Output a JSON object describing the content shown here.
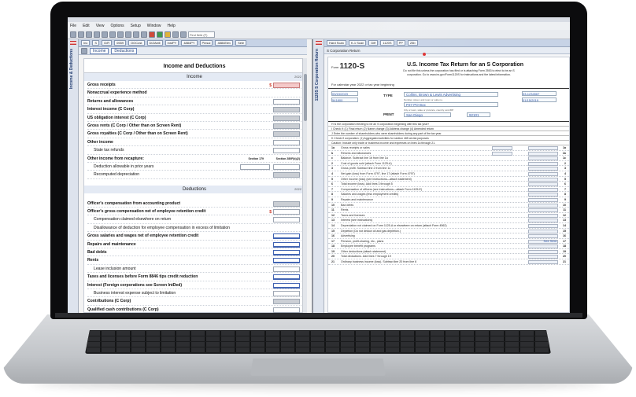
{
  "menu": [
    "File",
    "Edit",
    "View",
    "Options",
    "Setup",
    "Window",
    "Help"
  ],
  "toolbar": {
    "search_placeholder": "Find field (F)"
  },
  "left_pane": {
    "vertical_tab": "Income & Deductions",
    "form_bar": [
      "Inc",
      "S",
      "G/R",
      "0559",
      "OOCost",
      "DIZAbill",
      "InstPY",
      "4884PY",
      "Pinsul",
      "4884Elev",
      "Sele"
    ],
    "nav_tabs": [
      "Income",
      "Deductions"
    ],
    "sheet_title": "Income and Deductions",
    "income_section": "Income",
    "year_tag": "2022",
    "income_rows": [
      {
        "label": "Gross receipts",
        "indent": false,
        "box": "pk"
      },
      {
        "label": "Nonaccrual experience method",
        "indent": false,
        "box": "none"
      },
      {
        "label": "Returns and allowances",
        "indent": false,
        "box": "wh"
      },
      {
        "label": "Interest income (C Corp)",
        "indent": false,
        "box": "sh"
      },
      {
        "label": "US obligation interest (C Corp)",
        "indent": false,
        "box": "sh"
      },
      {
        "label": "Gross rents (C Corp / Other than on Screen Rent)",
        "indent": false,
        "box": "sh"
      },
      {
        "label": "Gross royalties (C Corp / Other than on Screen Rent)",
        "indent": false,
        "box": "sh"
      },
      {
        "label": "Other income",
        "indent": false,
        "box": "wh"
      },
      {
        "label": "State tax refunds",
        "indent": true,
        "box": "wh"
      },
      {
        "label": "Other income from recapture:",
        "indent": false,
        "box": "none"
      },
      {
        "label": "Deduction allowable in prior years",
        "indent": true,
        "box": "wh2"
      },
      {
        "label": "Recomputed depreciation",
        "indent": true,
        "box": "sh"
      }
    ],
    "recapture_cols": [
      "Section 179",
      "Section 280F(b)(2)"
    ],
    "deductions_section": "Deductions",
    "deduction_rows": [
      {
        "label": "Officer's compensation from accounting product",
        "indent": false,
        "box": "sh"
      },
      {
        "label": "Officer's gross compensation net of employee retention credit",
        "indent": false,
        "box": "wh"
      },
      {
        "label": "Compensation claimed elsewhere on return",
        "indent": true,
        "box": "wh"
      },
      {
        "label": "Disallowance of deduction for employee compensation in excess of limitation",
        "indent": true,
        "box": "none"
      },
      {
        "label": "Gross salaries and wages net of employee retention credit",
        "indent": false,
        "box": "bl"
      },
      {
        "label": "Repairs and maintenance",
        "indent": false,
        "box": "bl"
      },
      {
        "label": "Bad debts",
        "indent": false,
        "box": "bl"
      },
      {
        "label": "Rents",
        "indent": false,
        "box": "bl"
      },
      {
        "label": "Lease inclusion amount",
        "indent": true,
        "box": "wh"
      },
      {
        "label": "Taxes and licenses before Form 8846 tips credit reduction",
        "indent": false,
        "box": "bl"
      },
      {
        "label": "Interest (Foreign corporations see Screen IntDed)",
        "indent": false,
        "box": "bl"
      },
      {
        "label": "Business interest expense subject to limitation",
        "indent": true,
        "box": "wh"
      },
      {
        "label": "Contributions (C Corp)",
        "indent": false,
        "box": "sh"
      },
      {
        "label": "Qualified cash contributions (C Corp)",
        "indent": false,
        "box": "wh"
      }
    ]
  },
  "right_pane": {
    "vertical_tab": "1120S S Corporation Return",
    "bar": [
      "Hard Scan",
      "K-1 Scan",
      "Diff",
      "1120S",
      "PP",
      "25b"
    ],
    "doc_title": "S Corporation Return",
    "form_number": "1120-S",
    "form_title": "U.S. Income Tax Return for an S Corporation",
    "form_subtitle": "Do not file this unless the corporation has filed or is attaching Form 2553 to elect to be an S corporation. Go to www.irs.gov/Form1120S for instructions and the latest information.",
    "tax_year_line": "For calendar year 2022 or tax year beginning",
    "type_label": "TYPE",
    "print_label": "PRINT",
    "name_value": "Collins, Brown & Lewis Advertising",
    "address_value": "P27 PO Box",
    "city_value": "San Diego",
    "zip_value": "92101",
    "ein_value": "33-1234567",
    "date_value": "01/15/2019",
    "left_values": [
      "03/15/2023",
      "541800"
    ],
    "id_notes": [
      "Number, street, and room or suite no.",
      "City or town, state or province, country, and ZIP"
    ],
    "check_lines": [
      "H Is the corporation electing to be an S corporation beginning with this tax year?",
      "I Check if: (1) Final return (2) Name change (3) Address change (4) Amended return",
      "J Enter the number of shareholders who were shareholders during any part of the tax year",
      "K Check if corporation: (1) Aggregated activities for section 465 at-risk purposes",
      "Caution: Include only trade or business income and expenses on lines 1a through 21."
    ],
    "income_lines": [
      {
        "ln": "1a",
        "label": "Gross receipts or sales",
        "no": "1a"
      },
      {
        "ln": "b",
        "label": "Returns and allowances",
        "no": "1b"
      },
      {
        "ln": "c",
        "label": "Balance. Subtract line 1b from line 1a",
        "no": "1c"
      },
      {
        "ln": "2",
        "label": "Cost of goods sold (attach Form 1125-A)",
        "no": "2"
      },
      {
        "ln": "3",
        "label": "Gross profit. Subtract line 2 from line 1c",
        "no": "3"
      },
      {
        "ln": "4",
        "label": "Net gain (loss) from Form 4797, line 17 (attach Form 4797)",
        "no": "4"
      },
      {
        "ln": "5",
        "label": "Other income (loss) (see instructions—attach statement)",
        "no": "5"
      },
      {
        "ln": "6",
        "label": "Total income (loss). Add lines 3 through 5",
        "no": "6"
      },
      {
        "ln": "7",
        "label": "Compensation of officers (see instructions—attach Form 1125-E)",
        "no": "7"
      },
      {
        "ln": "8",
        "label": "Salaries and wages (less employment credits)",
        "no": "8"
      },
      {
        "ln": "9",
        "label": "Repairs and maintenance",
        "no": "9"
      },
      {
        "ln": "10",
        "label": "Bad debts",
        "no": "10"
      },
      {
        "ln": "11",
        "label": "Rents",
        "no": "11"
      },
      {
        "ln": "12",
        "label": "Taxes and licenses",
        "no": "12"
      },
      {
        "ln": "13",
        "label": "Interest (see instructions)",
        "no": "13"
      },
      {
        "ln": "14",
        "label": "Depreciation not claimed on Form 1125-A or elsewhere on return (attach Form 4562)",
        "no": "14"
      },
      {
        "ln": "15",
        "label": "Depletion (Do not deduct oil and gas depletion.)",
        "no": "15"
      },
      {
        "ln": "16",
        "label": "Advertising",
        "no": "16"
      },
      {
        "ln": "17",
        "label": "Pension, profit-sharing, etc., plans",
        "no": "17"
      },
      {
        "ln": "18",
        "label": "Employee benefit programs",
        "no": "18"
      },
      {
        "ln": "19",
        "label": "Other deductions (attach statement)",
        "no": "19"
      },
      {
        "ln": "20",
        "label": "Total deductions. Add lines 7 through 19",
        "no": "20"
      },
      {
        "ln": "21",
        "label": "Ordinary business income (loss). Subtract line 20 from line 6",
        "no": "21"
      }
    ],
    "stmt_value": "See Stmt"
  }
}
